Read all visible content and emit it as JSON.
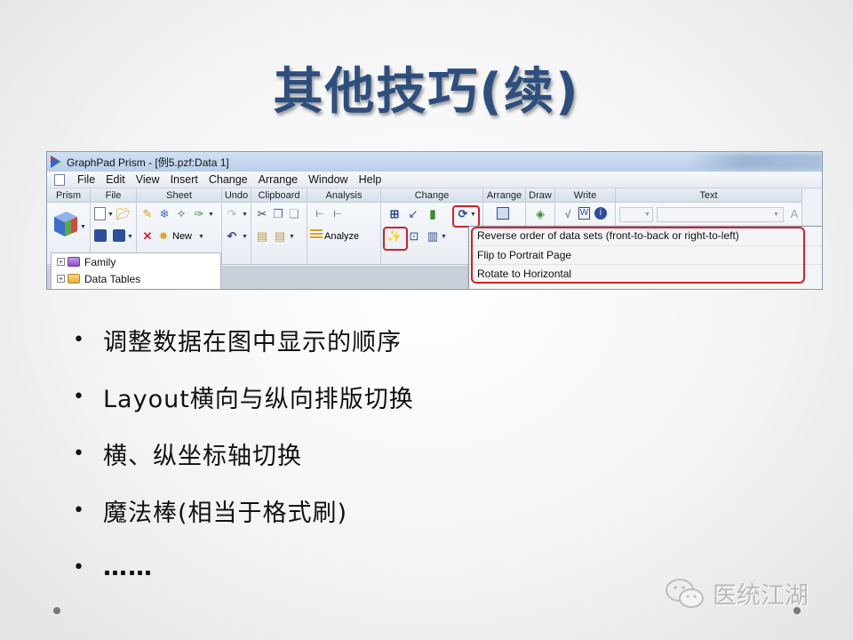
{
  "slide": {
    "title": "其他技巧(续)"
  },
  "app": {
    "window_title": "GraphPad Prism - [例5.pzf:Data 1]",
    "menu": [
      "File",
      "Edit",
      "View",
      "Insert",
      "Change",
      "Arrange",
      "Window",
      "Help"
    ],
    "toolbar_groups": [
      "Prism",
      "File",
      "Sheet",
      "Undo",
      "Clipboard",
      "Analysis",
      "Change",
      "Arrange",
      "Draw",
      "Write",
      "Text"
    ],
    "sheet_new_label": "New",
    "analyze_label": "Analyze",
    "navigator": {
      "items": [
        {
          "label": "Family",
          "expander": "+",
          "folder": "purple"
        },
        {
          "label": "Data Tables",
          "expander": "+",
          "folder": "yellow"
        }
      ]
    },
    "rotate_menu": {
      "items": [
        "Reverse order of data sets (front-to-back or right-to-left)",
        "Flip to Portrait Page",
        "Rotate to Horizontal"
      ]
    },
    "highlight_color": "#d42027"
  },
  "bullets": [
    "调整数据在图中显示的顺序",
    "Layout横向与纵向排版切换",
    "横、纵坐标轴切换",
    "魔法棒(相当于格式刷)",
    "……"
  ],
  "bullet_symbol": "•",
  "watermark": {
    "icon": "wechat-icon",
    "text": "医统江湖"
  },
  "colors": {
    "title": "#2e4f7e",
    "highlight": "#d42027"
  }
}
